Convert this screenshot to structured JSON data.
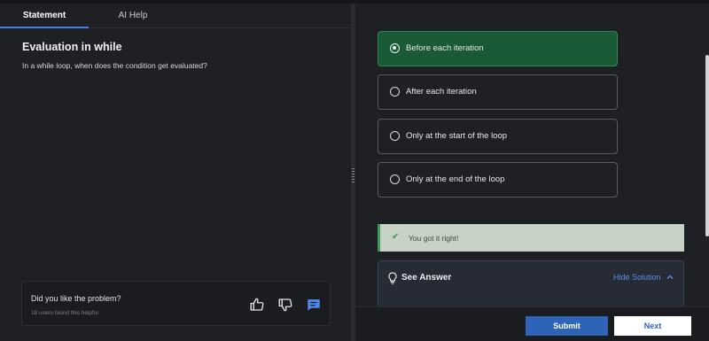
{
  "tabs": {
    "statement": "Statement",
    "ai_help": "AI Help"
  },
  "question": {
    "title": "Evaluation in while",
    "text": "In a while loop, when does the condition get evaluated?"
  },
  "feedback": {
    "prompt": "Did you like the problem?",
    "helpful_count": "18 users found this helpful",
    "icons": [
      "thumbs-up-icon",
      "thumbs-down-icon",
      "comment-icon"
    ]
  },
  "options": [
    {
      "label": "Before each iteration",
      "selected": true
    },
    {
      "label": "After each iteration",
      "selected": false
    },
    {
      "label": "Only at the start of the loop",
      "selected": false
    },
    {
      "label": "Only at the end of the loop",
      "selected": false
    }
  ],
  "result": {
    "message": "You got it right!",
    "icon": "check-icon"
  },
  "answer_panel": {
    "title": "See Answer",
    "toggle_label": "Hide Solution",
    "icon": "lightbulb-icon"
  },
  "actions": {
    "submit": "Submit",
    "next": "Next"
  },
  "colors": {
    "accent": "#2e64b8",
    "selected_bg": "#1a5a36",
    "success": "#3d9b5b"
  }
}
